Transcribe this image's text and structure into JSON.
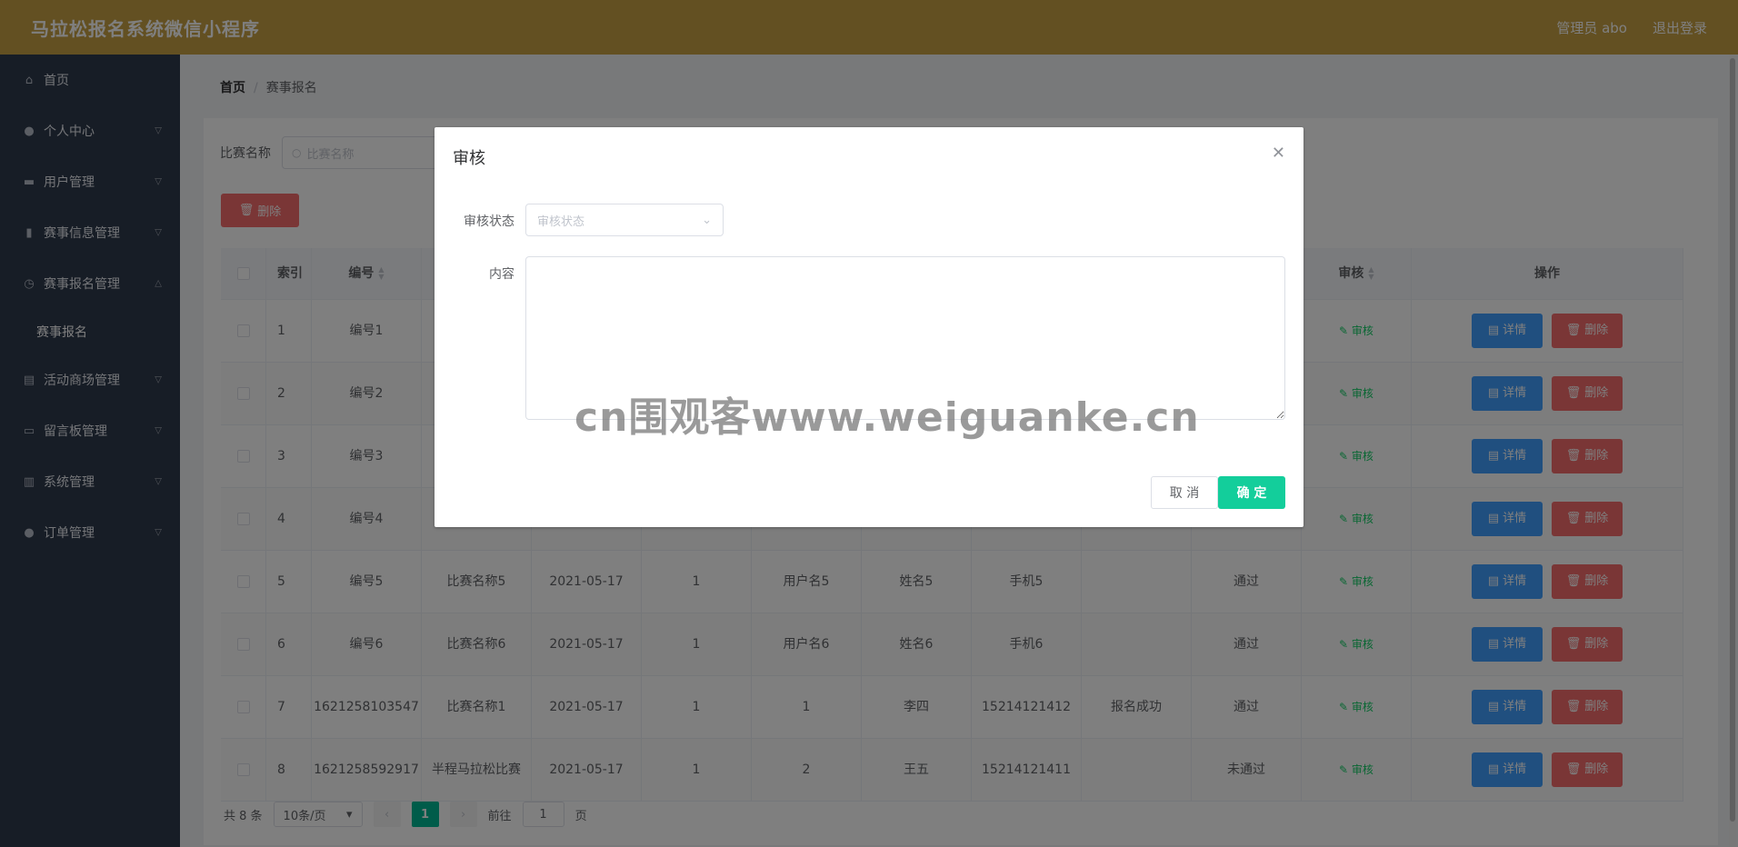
{
  "header": {
    "title": "马拉松报名系统微信小程序",
    "admin": "管理员 abo",
    "logout": "退出登录"
  },
  "sidebar": {
    "items": [
      {
        "label": "首页",
        "icon": "home-icon"
      },
      {
        "label": "个人中心",
        "icon": "user-icon"
      },
      {
        "label": "用户管理",
        "icon": "users-icon"
      },
      {
        "label": "赛事信息管理",
        "icon": "info-icon"
      },
      {
        "label": "赛事报名管理",
        "icon": "clock-icon"
      },
      {
        "label": "赛事报名",
        "icon": ""
      },
      {
        "label": "活动商场管理",
        "icon": "shop-icon"
      },
      {
        "label": "留言板管理",
        "icon": "message-icon"
      },
      {
        "label": "系统管理",
        "icon": "system-icon"
      },
      {
        "label": "订单管理",
        "icon": "order-icon"
      }
    ]
  },
  "breadcrumb": {
    "home": "首页",
    "sep": "/",
    "current": "赛事报名"
  },
  "filter": {
    "label": "比赛名称",
    "placeholder": "比赛名称"
  },
  "toolbar": {
    "delete_label": "删除"
  },
  "table": {
    "headers": {
      "index": "索引",
      "no": "编号",
      "review": "审核",
      "ops": "操作"
    },
    "review_link": "审核",
    "detail_label": "详情",
    "delete_label": "删除",
    "rows": [
      {
        "idx": "1",
        "no": "编号1",
        "name": "",
        "date": "",
        "num": "",
        "user": "",
        "real": "",
        "phone": "",
        "stat": "",
        "pass": ""
      },
      {
        "idx": "2",
        "no": "编号2",
        "name": "",
        "date": "",
        "num": "",
        "user": "",
        "real": "",
        "phone": "",
        "stat": "",
        "pass": ""
      },
      {
        "idx": "3",
        "no": "编号3",
        "name": "",
        "date": "",
        "num": "",
        "user": "",
        "real": "",
        "phone": "",
        "stat": "",
        "pass": ""
      },
      {
        "idx": "4",
        "no": "编号4",
        "name": "",
        "date": "",
        "num": "",
        "user": "",
        "real": "",
        "phone": "",
        "stat": "",
        "pass": ""
      },
      {
        "idx": "5",
        "no": "编号5",
        "name": "比赛名称5",
        "date": "2021-05-17",
        "num": "1",
        "user": "用户名5",
        "real": "姓名5",
        "phone": "手机5",
        "stat": "",
        "pass": "通过"
      },
      {
        "idx": "6",
        "no": "编号6",
        "name": "比赛名称6",
        "date": "2021-05-17",
        "num": "1",
        "user": "用户名6",
        "real": "姓名6",
        "phone": "手机6",
        "stat": "",
        "pass": "通过"
      },
      {
        "idx": "7",
        "no": "1621258103547",
        "name": "比赛名称1",
        "date": "2021-05-17",
        "num": "1",
        "user": "1",
        "real": "李四",
        "phone": "15214121412",
        "stat": "报名成功",
        "pass": "通过"
      },
      {
        "idx": "8",
        "no": "1621258592917",
        "name": "半程马拉松比赛",
        "date": "2021-05-17",
        "num": "1",
        "user": "2",
        "real": "王五",
        "phone": "15214121411",
        "stat": "",
        "pass": "未通过"
      }
    ]
  },
  "pagination": {
    "total": "共 8 条",
    "page_size": "10条/页",
    "current_page": "1",
    "goto_prefix": "前往",
    "goto_value": "1",
    "goto_suffix": "页"
  },
  "dialog": {
    "title": "审核",
    "status_label": "审核状态",
    "status_placeholder": "审核状态",
    "content_label": "内容",
    "cancel": "取 消",
    "confirm": "确 定"
  },
  "watermark": "cn围观客www.weiguanke.cn",
  "colors": {
    "header": "#c7a045",
    "sidebar": "#2f3a4d",
    "primary_button": "#409eff",
    "danger_button": "#f56c6c",
    "confirm_button": "#13ce9b",
    "pager_active": "#00b894"
  }
}
